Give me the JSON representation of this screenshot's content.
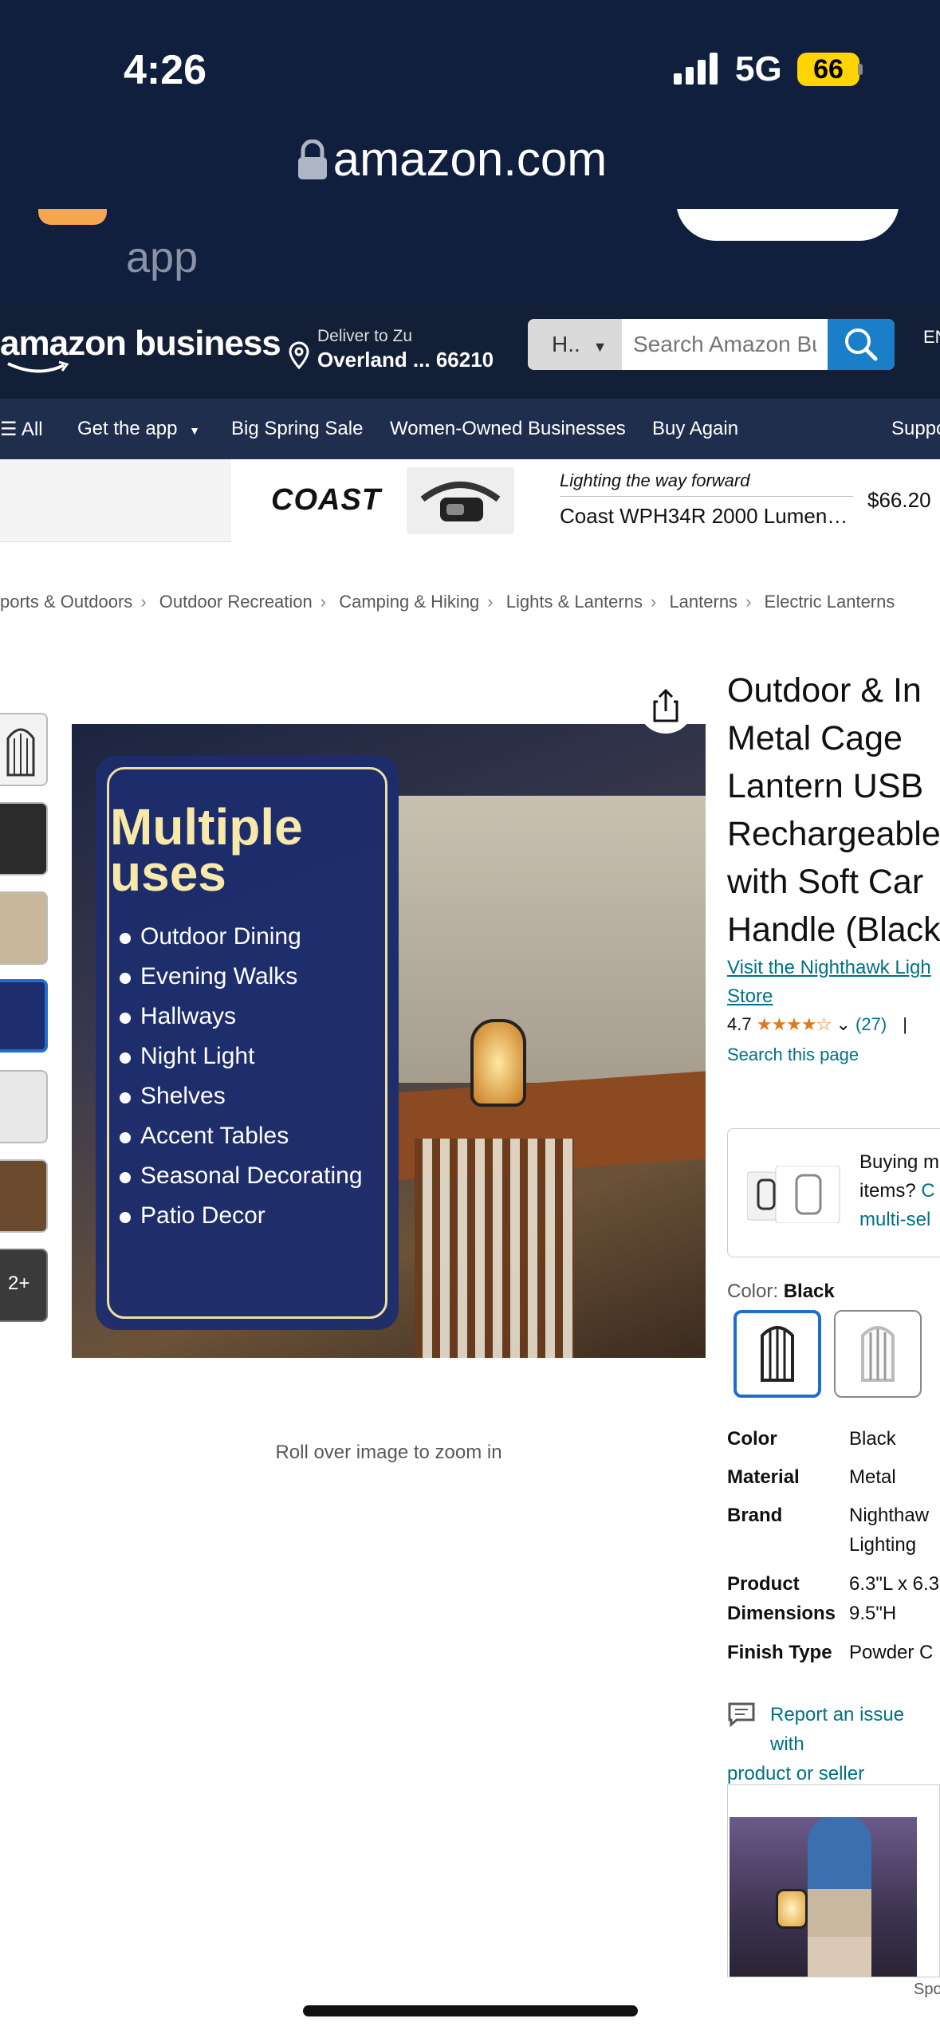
{
  "status": {
    "time": "4:26",
    "network": "5G",
    "battery": "66"
  },
  "browser": {
    "url": "amazon.com"
  },
  "app_banner": {
    "text": "app"
  },
  "header": {
    "logo": "amazon business",
    "deliver_line1": "Deliver to Zu",
    "deliver_line2": "Overland ... 66210",
    "search_dept": "H..",
    "search_placeholder": "Search Amazon Bu",
    "lang": "EN"
  },
  "nav": {
    "all": "All",
    "items": [
      "Get the app",
      "Big Spring Sale",
      "Women-Owned Businesses",
      "Buy Again",
      "Suppo"
    ]
  },
  "promo": {
    "brand": "COAST",
    "tagline": "Lighting the way forward",
    "title": "Coast WPH34R 2000 Lumen…",
    "price": "$66.20"
  },
  "breadcrumb": [
    "ports & Outdoors",
    "Outdoor Recreation",
    "Camping & Hiking",
    "Lights & Lanterns",
    "Lanterns",
    "Electric Lanterns"
  ],
  "gallery": {
    "more_label": "2+",
    "zoom_hint": "Roll over image to zoom in",
    "image_heading": "Multiple uses",
    "image_list": [
      "Outdoor Dining",
      "Evening Walks",
      "Hallways",
      "Night Light",
      "Shelves",
      "Accent Tables",
      "Seasonal Decorating",
      "Patio Decor"
    ]
  },
  "product": {
    "title_lines": [
      "Outdoor & In",
      "Metal Cage",
      "Lantern USB",
      "Rechargeable",
      "with Soft Car",
      "Handle (Black"
    ],
    "store_line1": "Visit the Nighthawk Ligh",
    "store_line2": "Store",
    "rating": "4.7",
    "stars": "★★★★☆",
    "review_count": "(27)",
    "divider": "|",
    "search_page": "Search this page",
    "multi_line1": "Buying m",
    "multi_line2": "items?",
    "multi_link1": "C",
    "multi_link2": "multi-sel",
    "color_label": "Color:",
    "color_value": "Black",
    "specs": [
      {
        "k": "Color",
        "v": "Black"
      },
      {
        "k": "Material",
        "v": "Metal"
      },
      {
        "k": "Brand",
        "v": "Nighthaw\nLighting"
      },
      {
        "k": "Product\nDimensions",
        "v": "6.3\"L x 6.3\n9.5\"H"
      },
      {
        "k": "Finish Type",
        "v": "Powder C"
      }
    ],
    "report_line1": "Report an issue with",
    "report_line2": "product or seller",
    "sponsored": "Spo"
  },
  "colors": {
    "nav_bg": "#1f2e4d",
    "header_bg": "#131f36",
    "link": "#007185",
    "search_btn": "#1a7fc8",
    "star": "#de7921",
    "selected_border": "#1e6ecf"
  }
}
